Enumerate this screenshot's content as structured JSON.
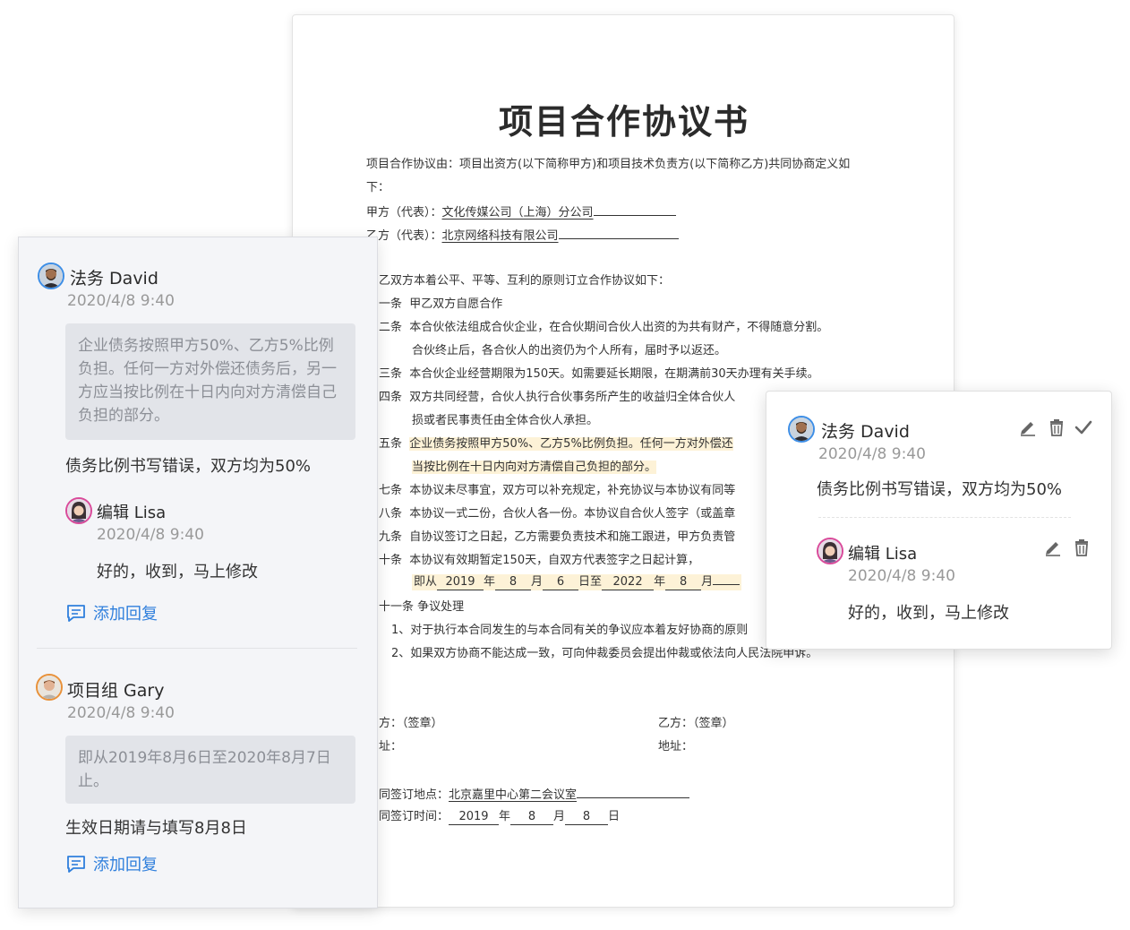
{
  "document": {
    "title": "项目合作协议书",
    "intro_line1": "项目合作协议由：项目出资方(以下简称甲方)和项目技术负责方(以下简称乙方)共同协商定义如",
    "intro_line2": "下：",
    "party_a_label": "甲方（代表）：",
    "party_a_value": "文化传媒公司（上海）分公司",
    "party_b_label": "乙方（代表）：",
    "party_b_value": "北京网络科技有限公司",
    "principle": "乙双方本着公平、平等、互利的原则订立合作协议如下：",
    "clauses": [
      {
        "no": "一条",
        "text": "甲乙双方自愿合作"
      },
      {
        "no": "二条",
        "text": "本合伙依法组成合伙企业，在合伙期间合伙人出资的为共有财产，不得随意分割。"
      },
      {
        "no": "",
        "text": "合伙终止后，各合伙人的出资仍为个人所有，届时予以返还。"
      },
      {
        "no": "三条",
        "text": "本合伙企业经营期限为150天。如需要延长期限，在期满前30天办理有关手续。"
      },
      {
        "no": "四条",
        "text": "双方共同经营，合伙人执行合伙事务所产生的收益归全体合伙人"
      },
      {
        "no": "",
        "text": "损或者民事责任由全体合伙人承担。"
      },
      {
        "no": "五条",
        "text": "企业债务按照甲方50%、乙方5%比例负担。任何一方对外偿还"
      },
      {
        "no": "",
        "text": "当按比例在十日内向对方清偿自己负担的部分。"
      },
      {
        "no": "七条",
        "text": "本协议未尽事宜，双方可以补充规定，补充协议与本协议有同等"
      },
      {
        "no": "八条",
        "text": "本协议一式二份，合伙人各一份。本协议自合伙人签字（或盖章"
      },
      {
        "no": "九条",
        "text": "自协议签订之日起，乙方需要负责技术和施工跟进，甲方负责管"
      },
      {
        "no": "十条",
        "text": "本协议有效期暂定150天，自双方代表签字之日起计算，"
      }
    ],
    "period": {
      "prefix": "即从",
      "y1": "2019",
      "y_label": "年",
      "m1": "8",
      "m_label": "月",
      "d1": "6",
      "to_label": "日至",
      "y2": "2022",
      "m2": "8",
      "m2_label": "月"
    },
    "dispute_title": "十一条   争议处理",
    "dispute_1": "1、对于执行本合同发生的与本合同有关的争议应本着友好协商的原则",
    "dispute_2": "2、如果双方协商不能达成一致，可向仲裁委员会提出仲裁或依法向人民法院申诉。",
    "sign_a": "方：（签章）",
    "addr_a": "址：",
    "sign_b": "乙方：（签章）",
    "addr_b": "地址：",
    "place_label": "同签订地点：",
    "place_value": "北京嘉里中心第二会议室",
    "time_label": "同签订时间：",
    "sign_year": "2019",
    "sign_y_label": "年",
    "sign_month": "8",
    "sign_m_label": "月",
    "sign_day": "8",
    "sign_d_label": "日"
  },
  "panel": {
    "thread1": {
      "author": "法务 David",
      "time": "2020/4/8 9:40",
      "quote": "企业债务按照甲方50%、乙方5%比例负担。任何一方对外偿还债务后，另一方应当按比例在十日内向对方清偿自己负担的部分。",
      "comment": "债务比例书写错误，双方均为50%",
      "reply": {
        "author": "编辑 Lisa",
        "time": "2020/4/8 9:40",
        "comment": "好的，收到，马上修改"
      },
      "add_reply": "添加回复"
    },
    "thread2": {
      "author": "项目组 Gary",
      "time": "2020/4/8 9:40",
      "quote": "即从2019年8月6日至2020年8月7日止。",
      "comment": "生效日期请与填写8月8日",
      "add_reply": "添加回复"
    }
  },
  "popup": {
    "author": "法务 David",
    "time": "2020/4/8 9:40",
    "comment": "债务比例书写错误，双方均为50%",
    "reply": {
      "author": "编辑 Lisa",
      "time": "2020/4/8 9:40",
      "comment": "好的，收到，马上修改"
    }
  },
  "colors": {
    "accent": "#2f7fdc",
    "highlight": "#fdf2d7",
    "david_ring": "#3d8ee6",
    "lisa_ring": "#d94a9a",
    "gary_ring": "#e8913a"
  }
}
